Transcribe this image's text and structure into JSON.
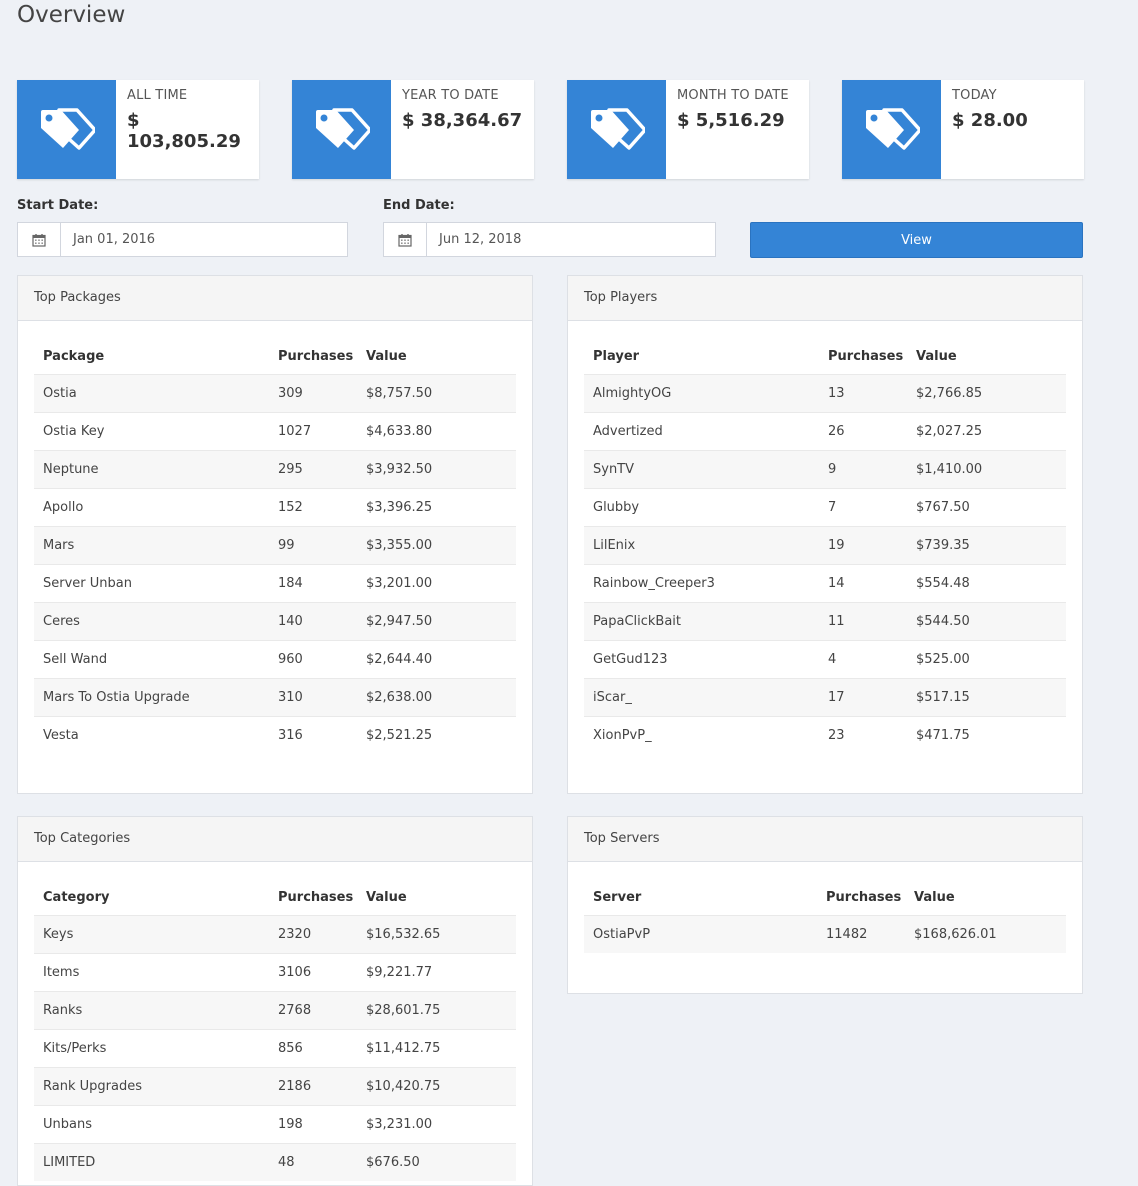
{
  "page": {
    "title": "Overview"
  },
  "stats": [
    {
      "label": "ALL TIME",
      "value": "$ 103,805.29",
      "icon": "tags-icon"
    },
    {
      "label": "YEAR TO DATE",
      "value": "$ 38,364.67",
      "icon": "tags-icon"
    },
    {
      "label": "MONTH TO DATE",
      "value": "$ 5,516.29",
      "icon": "tags-icon"
    },
    {
      "label": "TODAY",
      "value": "$ 28.00",
      "icon": "tags-icon"
    }
  ],
  "filters": {
    "start_label": "Start Date:",
    "start_value": "Jan 01, 2016",
    "end_label": "End Date:",
    "end_value": "Jun 12, 2018",
    "view_label": "View"
  },
  "colors": {
    "accent": "#3484d6"
  },
  "top_packages": {
    "title": "Top Packages",
    "headers": [
      "Package",
      "Purchases",
      "Value"
    ],
    "rows": [
      [
        "Ostia",
        "309",
        "$8,757.50"
      ],
      [
        "Ostia Key",
        "1027",
        "$4,633.80"
      ],
      [
        "Neptune",
        "295",
        "$3,932.50"
      ],
      [
        "Apollo",
        "152",
        "$3,396.25"
      ],
      [
        "Mars",
        "99",
        "$3,355.00"
      ],
      [
        "Server Unban",
        "184",
        "$3,201.00"
      ],
      [
        "Ceres",
        "140",
        "$2,947.50"
      ],
      [
        "Sell Wand",
        "960",
        "$2,644.40"
      ],
      [
        "Mars To Ostia Upgrade",
        "310",
        "$2,638.00"
      ],
      [
        "Vesta",
        "316",
        "$2,521.25"
      ]
    ]
  },
  "top_players": {
    "title": "Top Players",
    "headers": [
      "Player",
      "Purchases",
      "Value"
    ],
    "rows": [
      [
        "AlmightyOG",
        "13",
        "$2,766.85"
      ],
      [
        "Advertized",
        "26",
        "$2,027.25"
      ],
      [
        "SynTV",
        "9",
        "$1,410.00"
      ],
      [
        "Glubby",
        "7",
        "$767.50"
      ],
      [
        "LilEnix",
        "19",
        "$739.35"
      ],
      [
        "Rainbow_Creeper3",
        "14",
        "$554.48"
      ],
      [
        "PapaClickBait",
        "11",
        "$544.50"
      ],
      [
        "GetGud123",
        "4",
        "$525.00"
      ],
      [
        "iScar_",
        "17",
        "$517.15"
      ],
      [
        "XionPvP_",
        "23",
        "$471.75"
      ]
    ]
  },
  "top_categories": {
    "title": "Top Categories",
    "headers": [
      "Category",
      "Purchases",
      "Value"
    ],
    "rows": [
      [
        "Keys",
        "2320",
        "$16,532.65"
      ],
      [
        "Items",
        "3106",
        "$9,221.77"
      ],
      [
        "Ranks",
        "2768",
        "$28,601.75"
      ],
      [
        "Kits/Perks",
        "856",
        "$11,412.75"
      ],
      [
        "Rank Upgrades",
        "2186",
        "$10,420.75"
      ],
      [
        "Unbans",
        "198",
        "$3,231.00"
      ],
      [
        "LIMITED",
        "48",
        "$676.50"
      ]
    ]
  },
  "top_servers": {
    "title": "Top Servers",
    "headers": [
      "Server",
      "Purchases",
      "Value"
    ],
    "rows": [
      [
        "OstiaPvP",
        "11482",
        "$168,626.01"
      ]
    ]
  }
}
